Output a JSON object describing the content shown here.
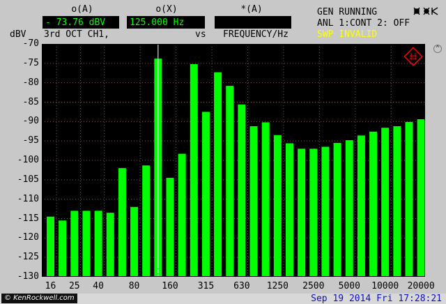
{
  "header": {
    "marker_a_label": "o(A)",
    "marker_x_label": "o(X)",
    "delta_a_label": "*(A)",
    "marker_a_value": "- 73.76 dBV",
    "marker_x_value": "125.000  Hz",
    "delta_a_value": "",
    "y_unit": "dBV",
    "trace_desc": "3rd OCT  CH1,",
    "vs_label": "vs",
    "x_desc": "FREQUENCY/Hz",
    "status_line1": "GEN RUNNING",
    "status_line2": "ANL 1:CONT 2: OFF",
    "status_line3": "SWP INVALID",
    "remote_icon": "remote-icon"
  },
  "colors": {
    "bar": "#00ff00",
    "plot_bg": "#000000",
    "readout_text": "#00ff00",
    "warning_text": "#ffff00",
    "logo": "#ff0000",
    "grid": "#7a5a5a",
    "cursor": "#ffffff"
  },
  "chart_data": {
    "type": "bar",
    "title": "",
    "xlabel": "FREQUENCY/Hz",
    "ylabel": "dBV",
    "ylim": [
      -130,
      -70
    ],
    "y_ticks": [
      "-70",
      "-75",
      "-80",
      "-85",
      "-90",
      "-95",
      "-100",
      "-105",
      "-110",
      "-115",
      "-120",
      "-125",
      "-130"
    ],
    "x_tick_labels": [
      "16",
      "25",
      "40",
      "80",
      "160",
      "315",
      "630",
      "1250",
      "2500",
      "5000",
      "10000",
      "20000"
    ],
    "x_tick_bar_index": [
      0,
      2,
      4,
      7,
      10,
      13,
      16,
      19,
      22,
      25,
      28,
      31
    ],
    "categories": [
      "16",
      "20",
      "25",
      "31.5",
      "40",
      "50",
      "63",
      "80",
      "100",
      "125",
      "160",
      "200",
      "250",
      "315",
      "400",
      "500",
      "630",
      "800",
      "1000",
      "1250",
      "1600",
      "2000",
      "2500",
      "3150",
      "4000",
      "5000",
      "6300",
      "8000",
      "10000",
      "12500",
      "16000",
      "20000"
    ],
    "series": [
      {
        "values": [
          -114.5,
          -115.5,
          -113.0,
          -113.0,
          -113.0,
          -113.5,
          -102.0,
          -112.0,
          -101.3,
          -73.8,
          -104.5,
          -98.3,
          -75.2,
          -87.5,
          -77.3,
          -80.8,
          -85.6,
          -91.2,
          -90.2,
          -93.5,
          -95.6,
          -97.0,
          -97.0,
          -96.5,
          -95.5,
          -94.8,
          -93.6,
          -92.6,
          -91.6,
          -91.2,
          -90.1,
          -89.4
        ]
      }
    ],
    "marker_bar_index": 9,
    "grid": true
  },
  "footer": {
    "watermark": "© KenRockwell.com",
    "datetime": "Sep 19 2014 Fri 17:28:21"
  }
}
